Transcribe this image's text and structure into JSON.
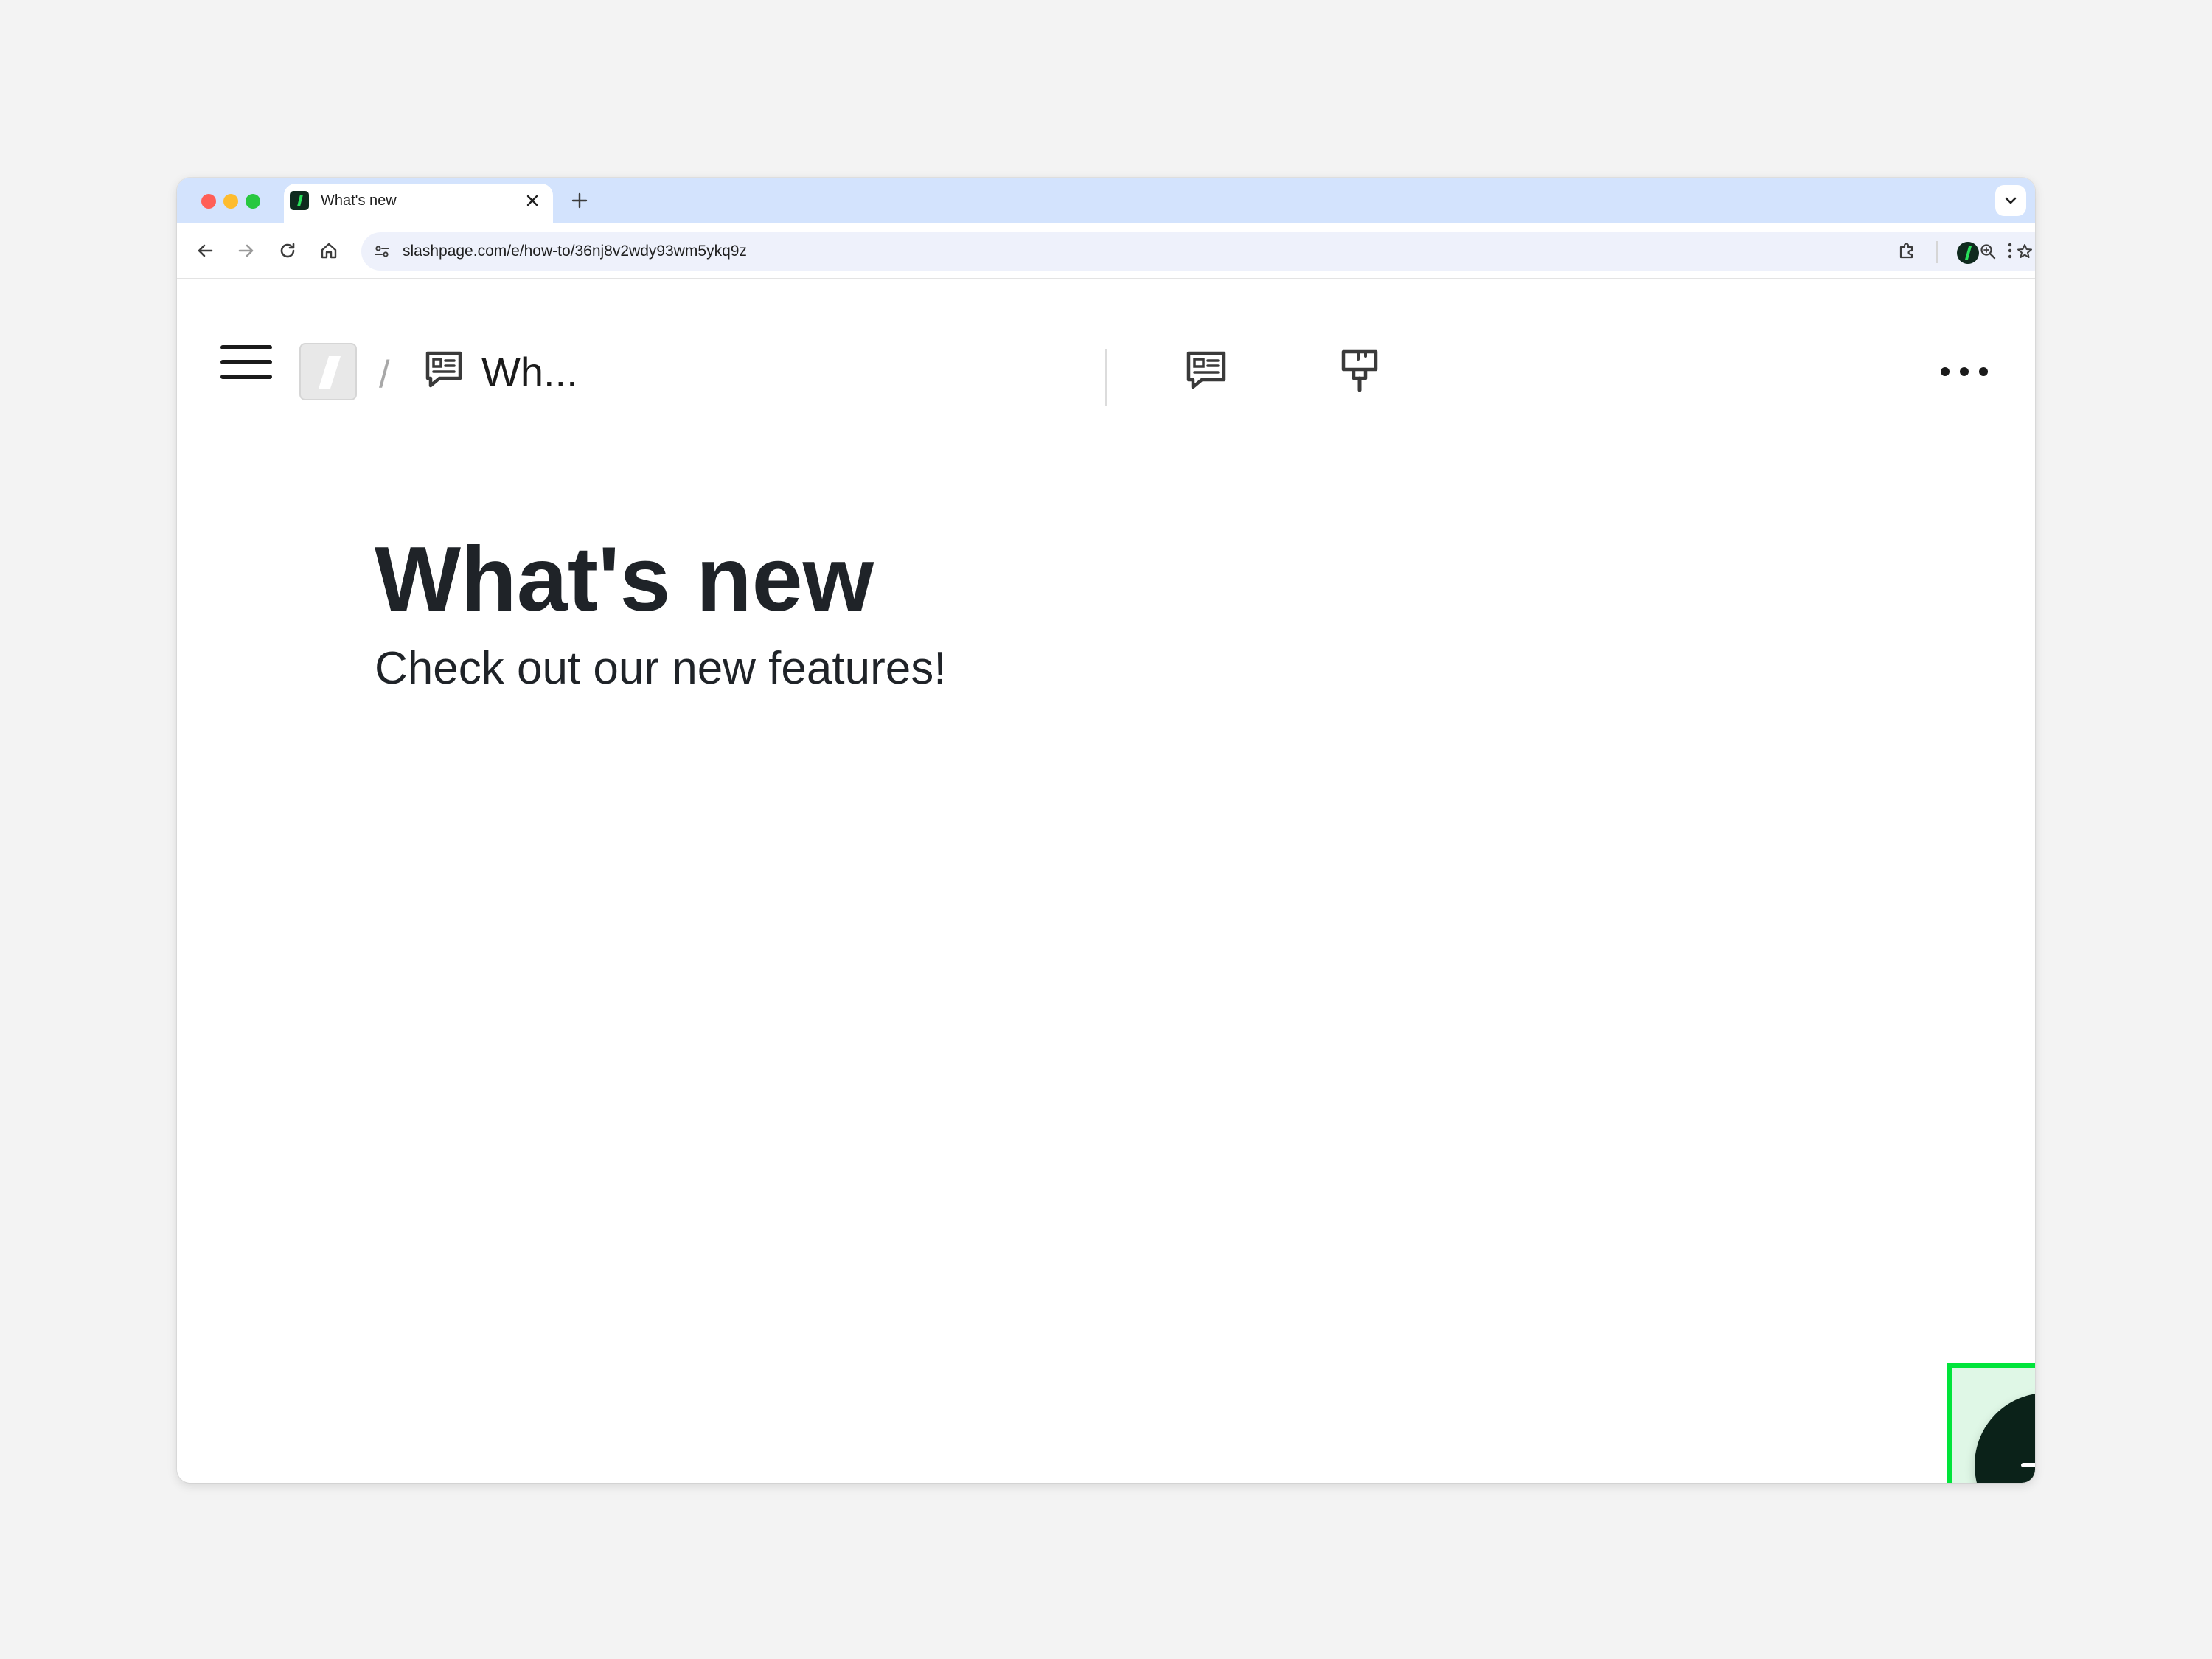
{
  "browser": {
    "tab": {
      "title": "What's new"
    },
    "address_bar": {
      "url": "slashpage.com/e/how-to/36nj8v2wdy93wm5ykq9z"
    }
  },
  "app": {
    "breadcrumb": {
      "separator": "/",
      "page_title_truncated": "Wh..."
    },
    "page": {
      "title": "What's new",
      "subtitle": "Check out our new features!"
    }
  },
  "colors": {
    "tabstrip": "#d3e3fd",
    "brand_dark": "#0b2219",
    "brand_green": "#00e43a",
    "highlight_fill": "#dff7e6"
  },
  "icons": {
    "menu": "hamburger-icon",
    "breadcrumb_page": "board-icon",
    "header_left": "board-icon",
    "header_right": "paint-roller-icon",
    "more": "more-horizontal-icon",
    "fab": "plus-icon",
    "callout": "arrow-icon"
  }
}
